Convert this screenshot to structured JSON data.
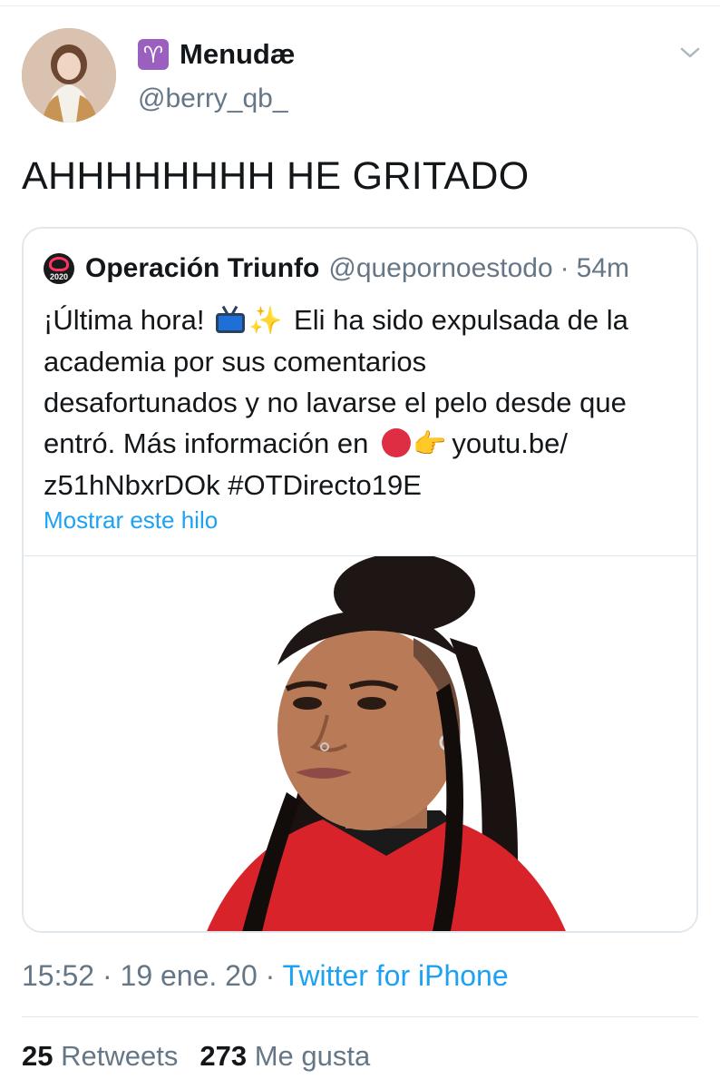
{
  "author": {
    "name_badge": "♈",
    "display_name": "Menudæ",
    "handle": "@berry_qb_"
  },
  "tweet": {
    "text": "AHHHHHHHH HE GRITADO"
  },
  "quoted": {
    "logo_year": "2020",
    "display_name": "Operación Triunfo",
    "handle": "@quepornoestodo",
    "separator": "·",
    "time": "54m",
    "lines": [
      {
        "before": "¡Última hora!",
        "after": "Eli ha sido expulsada de la"
      },
      {
        "text": "academia por sus comentarios"
      },
      {
        "text": "desafortunados y no lavarse el pelo desde que"
      },
      {
        "before": "entró. Más información en",
        "after": "youtu.be/"
      },
      {
        "text": "z51hNbxrDOk #OTDirecto19E"
      }
    ],
    "emoji": {
      "tv": "tv-icon",
      "sparkles": "✨",
      "red_circle": "red-circle-icon",
      "pointing": "👉"
    },
    "show_thread": "Mostrar este hilo"
  },
  "meta": {
    "time": "15:52",
    "dot1": "·",
    "date": "19 ene. 20",
    "dot2": "·",
    "source": "Twitter for iPhone"
  },
  "stats": {
    "retweets_count": "25",
    "retweets_label": "Retweets",
    "likes_count": "273",
    "likes_label": "Me gusta"
  },
  "colors": {
    "link": "#1da1f2",
    "secondary_text": "#657786",
    "primary_text": "#14171a",
    "aries_badge": "#9b5fc0"
  }
}
